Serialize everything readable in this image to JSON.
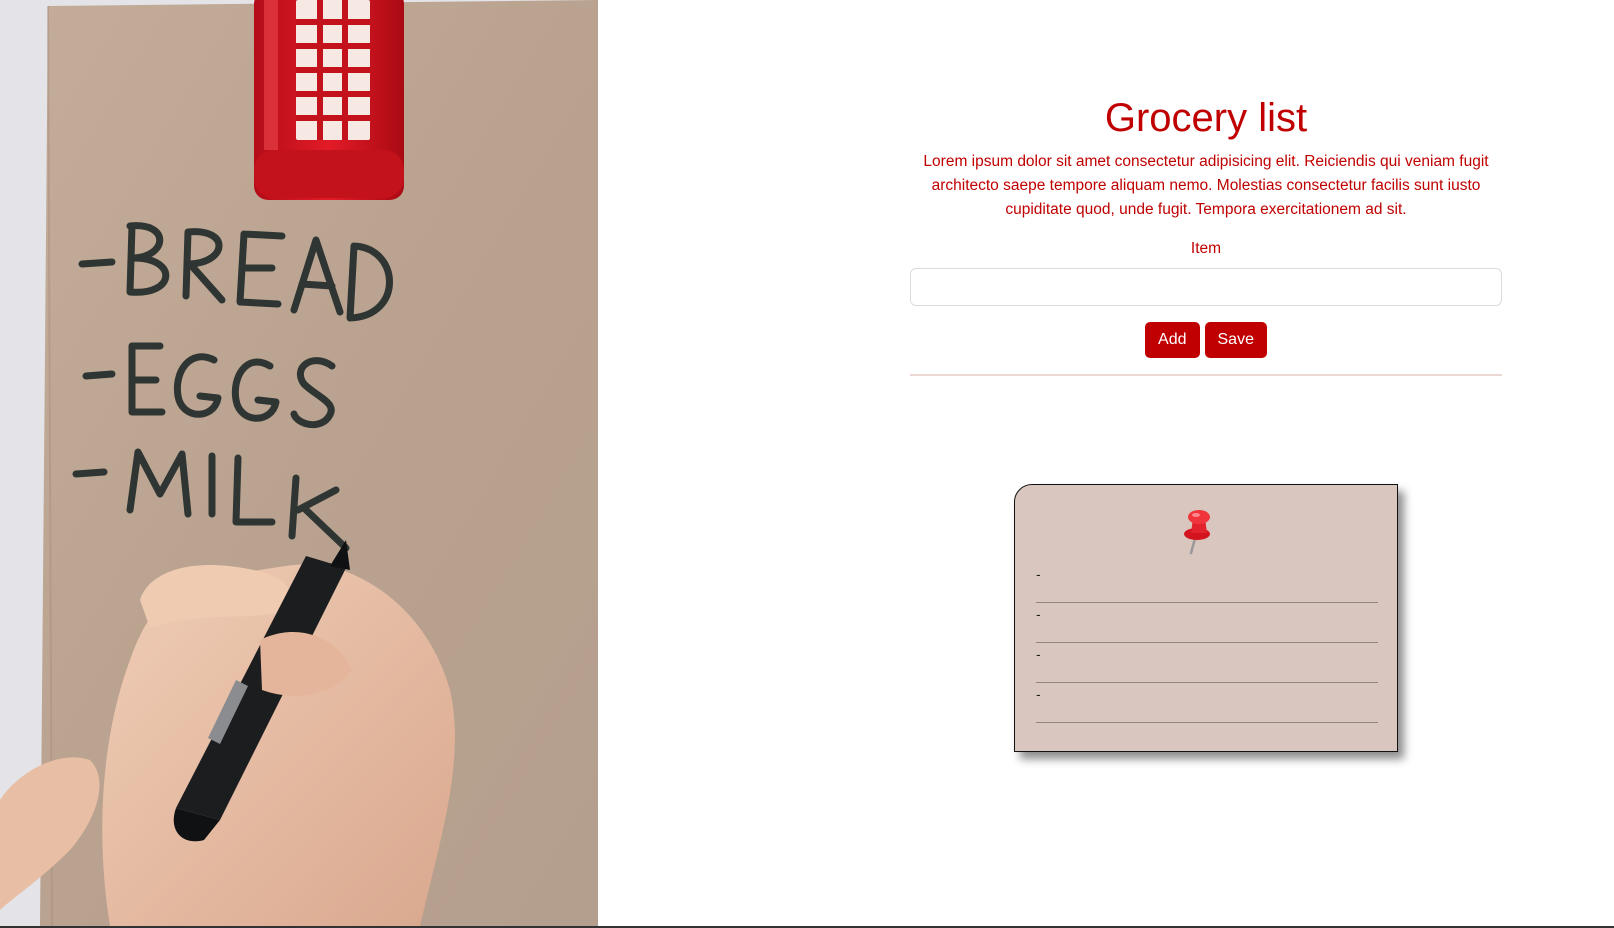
{
  "photo": {
    "list_lines": [
      "-BREAD",
      "-EGGS",
      "-MILK"
    ]
  },
  "header": {
    "title": "Grocery list",
    "description": "Lorem ipsum dolor sit amet consectetur adipisicing elit. Reiciendis qui veniam fugit architecto saepe tempore aliquam nemo. Molestias consectetur facilis sunt iusto cupiditate quod, unde fugit. Tempora exercitationem ad sit."
  },
  "form": {
    "item_label": "Item",
    "item_value": "",
    "add_label": "Add",
    "save_label": "Save"
  },
  "note": {
    "icon": "pushpin-icon",
    "items": [
      "-",
      "-",
      "-",
      "-"
    ]
  },
  "colors": {
    "accent": "#c00000",
    "note_background": "#d9c6be",
    "divider": "#ecd9d4"
  }
}
